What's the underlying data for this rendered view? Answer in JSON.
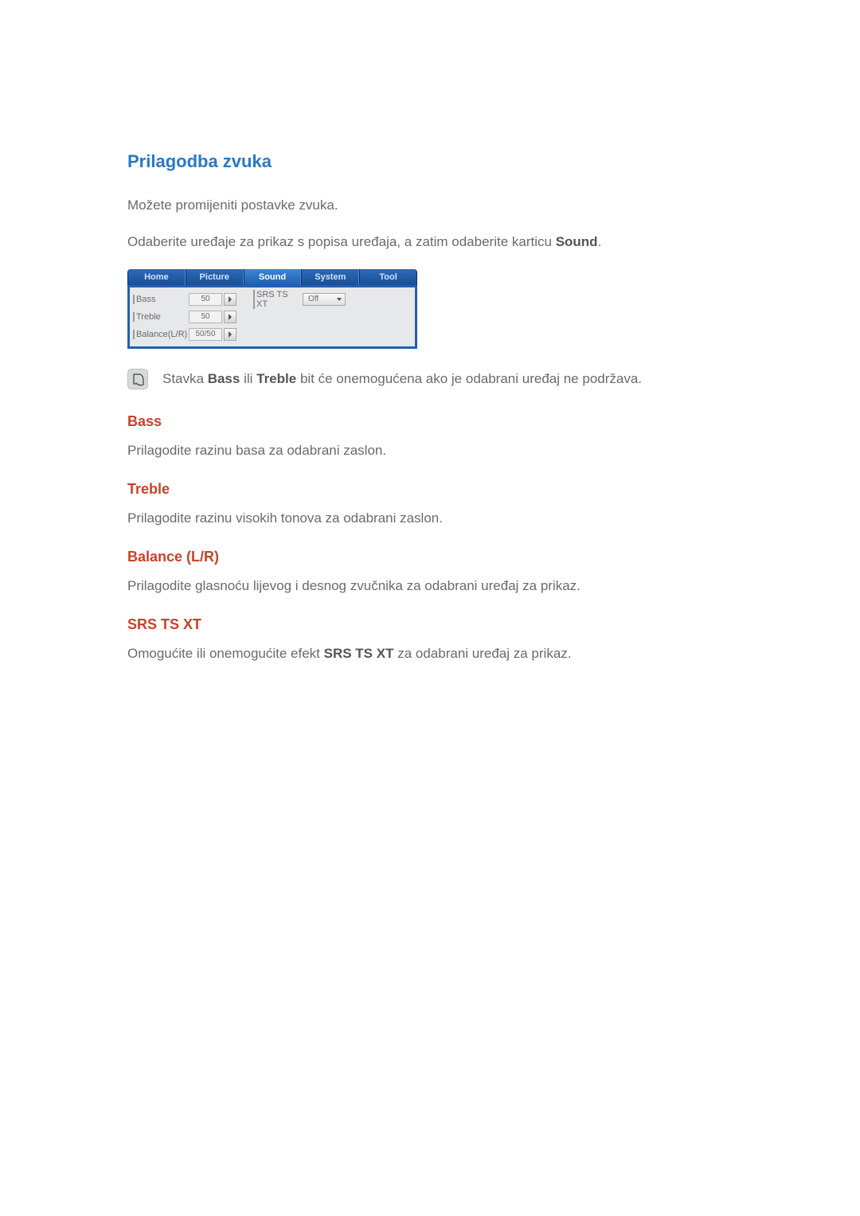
{
  "title": "Prilagodba zvuka",
  "intro1": "Možete promijeniti postavke zvuka.",
  "intro2_pre": "Odaberite uređaje za prikaz s popisa uređaja, a zatim odaberite karticu ",
  "intro2_bold": "Sound",
  "intro2_post": ".",
  "tabs": {
    "home": "Home",
    "picture": "Picture",
    "sound": "Sound",
    "system": "System",
    "tool": "Tool"
  },
  "settings": {
    "bass_label": "Bass",
    "bass_value": "50",
    "treble_label": "Treble",
    "treble_value": "50",
    "balance_label": "Balance(L/R)",
    "balance_value": "50/50",
    "srs_label": "SRS TS XT",
    "srs_value": "Off"
  },
  "note": {
    "pre": "Stavka ",
    "b1": "Bass",
    "mid": " ili ",
    "b2": "Treble",
    "post": " bit će onemogućena ako je odabrani uređaj ne podržava."
  },
  "sections": {
    "bass": {
      "title": "Bass",
      "text": "Prilagodite razinu basa za odabrani zaslon."
    },
    "treble": {
      "title": "Treble",
      "text": "Prilagodite razinu visokih tonova za odabrani zaslon."
    },
    "balance": {
      "title": "Balance (L/R)",
      "text": "Prilagodite glasnoću lijevog i desnog zvučnika za odabrani uređaj za prikaz."
    },
    "srs": {
      "title": "SRS TS XT",
      "text_pre": "Omogućite ili onemogućite efekt ",
      "text_bold": "SRS TS XT",
      "text_post": " za odabrani uređaj za prikaz."
    }
  }
}
